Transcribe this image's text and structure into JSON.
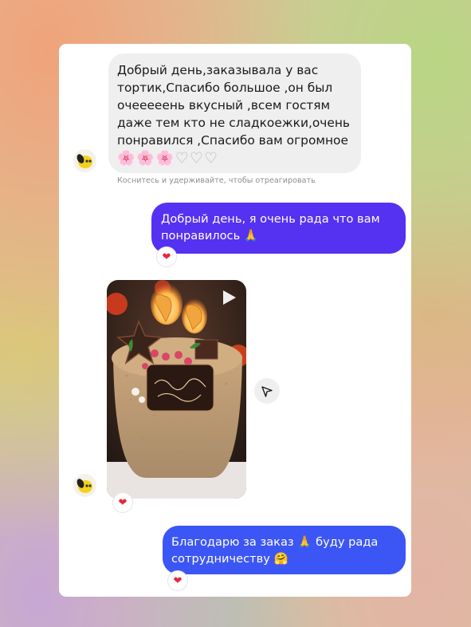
{
  "colors": {
    "incoming_bubble": "#efefef",
    "outgoing_bubble_1": "#5531f2",
    "outgoing_bubble_2": "#3c56f5",
    "reaction_heart": "#e8263f",
    "card_background": "#ffffff"
  },
  "messages": [
    {
      "direction": "incoming",
      "text": "Добрый день,заказывала у вас тортик,Спасибо большое ,он был очееееень вкусный ,всем гостям даже тем кто не сладкоежки,очень понравился ,Спасибо вам огромное",
      "emoji_row": "🌸🌸🌸",
      "emoji_hearts": "♥♥♥",
      "hint": "Коснитесь и удерживайте, чтобы отреагировать",
      "avatar_icon": "lemon-avatar-icon"
    },
    {
      "direction": "outgoing",
      "text": "Добрый день, я очень рада что вам понравилось 🙏",
      "reaction": "❤"
    },
    {
      "direction": "incoming",
      "type": "video",
      "media_icon": "play-icon",
      "share_icon": "send-icon",
      "avatar_icon": "lemon-avatar-icon",
      "reaction": "❤"
    },
    {
      "direction": "outgoing",
      "text": "Благодарю за заказ 🙏 буду рада сотрудничеству 🤗",
      "reaction": "❤"
    }
  ]
}
